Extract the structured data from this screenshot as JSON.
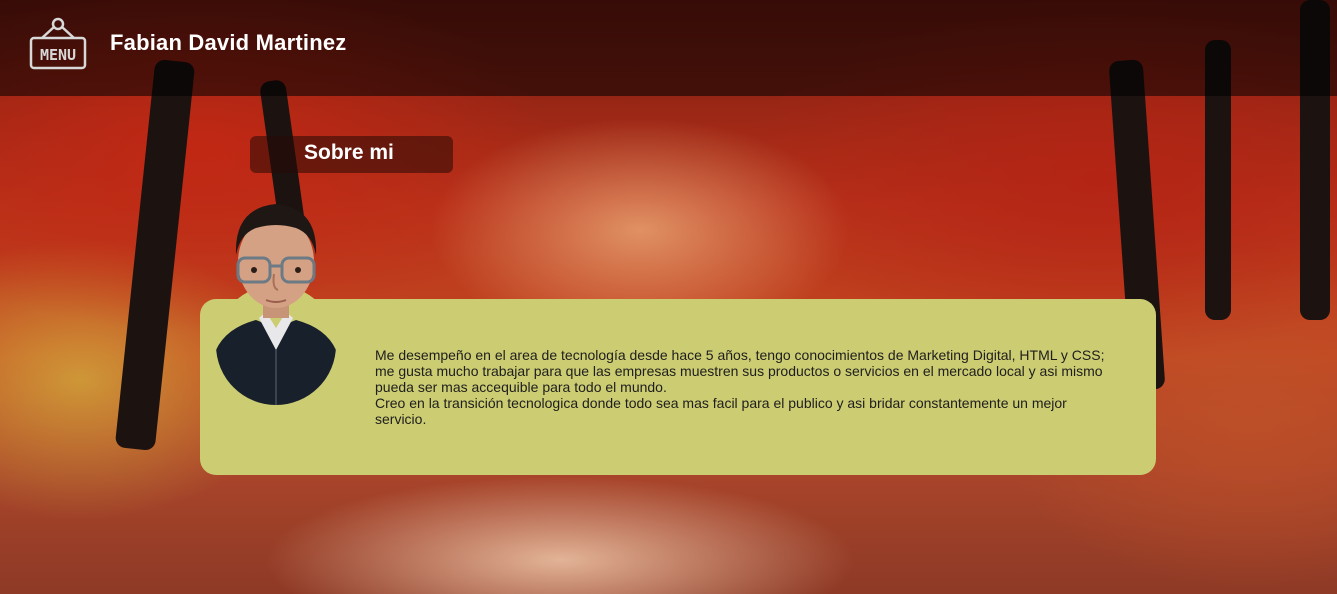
{
  "header": {
    "menu_icon": "menu-sign-icon",
    "menu_label": "MENU",
    "site_name": "Fabian David Martinez"
  },
  "about": {
    "section_title": "Sobre mi",
    "paragraph_1": "Me desempeño en el area de tecnología desde hace 5 años, tengo conocimientos de Marketing Digital, HTML y CSS; me gusta mucho trabajar para que las empresas muestren sus productos o servicios en el mercado local y asi mismo pueda ser mas accequible para todo el mundo.",
    "paragraph_2": "Creo en la transición tecnologica donde todo sea mas facil para el publico y asi bridar constantemente un mejor servicio.",
    "photo_icon": "profile-photo"
  },
  "colors": {
    "card_background": "#cccc72",
    "header_overlay": "rgba(0,0,0,0.55)",
    "title_text": "#ffffff"
  }
}
